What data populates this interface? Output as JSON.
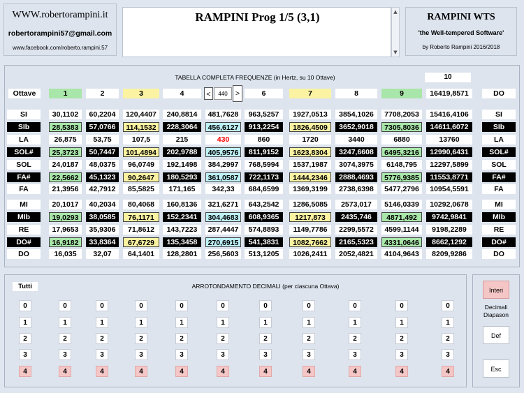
{
  "header": {
    "website": "WWW.robertorampini.it",
    "email": "robertorampini57@gmail.com",
    "facebook": "www.facebook.com/roberto.rampini.57",
    "title": "RAMPINI Prog 1/5 (3,1)",
    "app_name": "RAMPINI WTS",
    "tagline": "'the Well-tempered Software'",
    "byline": "by Roberto Rampini 2016/2018"
  },
  "table": {
    "title": "TABELLA COMPLETA FREQUENZE (in Hertz, su 10 Ottave)",
    "ottave_label": "Ottave",
    "octave_count": "10",
    "octaves": [
      "1",
      "2",
      "3",
      "4",
      "440",
      "6",
      "7",
      "8",
      "9",
      "16419,8571"
    ],
    "do_label": "DO",
    "prev_button": "<",
    "next_button": ">",
    "rows": [
      {
        "note": "SI",
        "dark": false,
        "values": [
          "30,1102",
          "60,2204",
          "120,4407",
          "240,8814",
          "481,7628",
          "963,5257",
          "1927,0513",
          "3854,1026",
          "7708,2053",
          "15416,4106"
        ]
      },
      {
        "note": "SIb",
        "dark": true,
        "values": [
          "28,5383",
          "57,0766",
          "114,1532",
          "228,3064",
          "456,6127",
          "913,2254",
          "1826,4509",
          "3652,9018",
          "7305,8036",
          "14611,6072"
        ]
      },
      {
        "note": "LA",
        "dark": false,
        "values": [
          "26,875",
          "53,75",
          "107,5",
          "215",
          "430",
          "860",
          "1720",
          "3440",
          "6880",
          "13760"
        ]
      },
      {
        "note": "SOL#",
        "dark": true,
        "values": [
          "25,3723",
          "50,7447",
          "101,4894",
          "202,9788",
          "405,9576",
          "811,9152",
          "1623,8304",
          "3247,6608",
          "6495,3216",
          "12990,6431"
        ]
      },
      {
        "note": "SOL",
        "dark": false,
        "values": [
          "24,0187",
          "48,0375",
          "96,0749",
          "192,1498",
          "384,2997",
          "768,5994",
          "1537,1987",
          "3074,3975",
          "6148,795",
          "12297,5899"
        ]
      },
      {
        "note": "FA#",
        "dark": true,
        "values": [
          "22,5662",
          "45,1323",
          "90,2647",
          "180,5293",
          "361,0587",
          "722,1173",
          "1444,2346",
          "2888,4693",
          "5776,9385",
          "11553,8771"
        ]
      },
      {
        "note": "FA",
        "dark": false,
        "values": [
          "21,3956",
          "42,7912",
          "85,5825",
          "171,165",
          "342,33",
          "684,6599",
          "1369,3199",
          "2738,6398",
          "5477,2796",
          "10954,5591"
        ]
      },
      {
        "note": "MI",
        "dark": false,
        "values": [
          "20,1017",
          "40,2034",
          "80,4068",
          "160,8136",
          "321,6271",
          "643,2542",
          "1286,5085",
          "2573,017",
          "5146,0339",
          "10292,0678"
        ]
      },
      {
        "note": "MIb",
        "dark": true,
        "values": [
          "19,0293",
          "38,0585",
          "76,1171",
          "152,2341",
          "304,4683",
          "608,9365",
          "1217,873",
          "2435,746",
          "4871,492",
          "9742,9841"
        ]
      },
      {
        "note": "RE",
        "dark": false,
        "values": [
          "17,9653",
          "35,9306",
          "71,8612",
          "143,7223",
          "287,4447",
          "574,8893",
          "1149,7786",
          "2299,5572",
          "4599,1144",
          "9198,2289"
        ]
      },
      {
        "note": "DO#",
        "dark": true,
        "values": [
          "16,9182",
          "33,8364",
          "67,6729",
          "135,3458",
          "270,6915",
          "541,3831",
          "1082,7662",
          "2165,5323",
          "4331,0646",
          "8662,1292"
        ]
      },
      {
        "note": "DO",
        "dark": false,
        "values": [
          "16,035",
          "32,07",
          "64,1401",
          "128,2801",
          "256,5603",
          "513,1205",
          "1026,2411",
          "2052,4821",
          "4104,9643",
          "8209,9286"
        ]
      }
    ]
  },
  "rounding": {
    "title": "ARROTONDAMENTO DECIMALI (per ciascuna Ottava)",
    "tutti_label": "Tutti",
    "levels": [
      "0",
      "1",
      "2",
      "3",
      "4"
    ]
  },
  "side": {
    "interi_label": "Interi",
    "decimali_label": "Decimali",
    "diapason_label": "Diapason",
    "def_label": "Def",
    "esc_label": "Esc"
  },
  "colors": {
    "green": "#a9e6a9",
    "yellow": "#fbf3a2",
    "cyan": "#bdf0f5",
    "red_text": "#ff0000",
    "pink": "#f5c6c6"
  }
}
